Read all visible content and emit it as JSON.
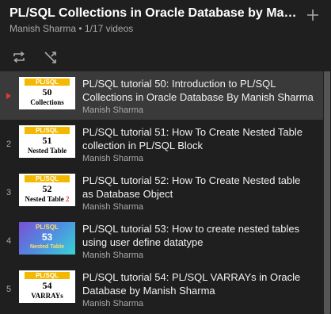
{
  "playlist": {
    "title": "PL/SQL Collections in Oracle Database by Manish Sharma",
    "meta": "Manish Sharma • 1/17 videos"
  },
  "icons": {
    "add": "plus-icon",
    "loop": "loop-icon",
    "shuffle": "shuffle-icon",
    "now_playing": "play-indicator-icon"
  },
  "colors": {
    "background": "#1f1f1f",
    "active_row": "#3a3a3a",
    "now_playing": "#e53935",
    "thumb_band": "#f5b800"
  },
  "videos": [
    {
      "index": "",
      "title": "PL/SQL tutorial 50: Introduction to PL/SQL Collections in Oracle Database By Manish Sharma",
      "channel": "Manish Sharma",
      "thumb": {
        "band": "PL/SQL",
        "number": "50",
        "subtitle": "Collections",
        "subtitle_accent": ""
      }
    },
    {
      "index": "2",
      "title": "PL/SQL tutorial 51: How To Create Nested Table collection in PL/SQL Block",
      "channel": "Manish Sharma",
      "thumb": {
        "band": "PL/SQL",
        "number": "51",
        "subtitle": "Nested Table",
        "subtitle_accent": ""
      }
    },
    {
      "index": "3",
      "title": "PL/SQL tutorial 52: How To Create Nested table as Database Object",
      "channel": "Manish Sharma",
      "thumb": {
        "band": "PL/SQL",
        "number": "52",
        "subtitle": "Nested Table",
        "subtitle_accent": "2"
      }
    },
    {
      "index": "4",
      "title": "PL/SQL tutorial 53: How to create nested tables using user define datatype",
      "channel": "Manish Sharma",
      "thumb": {
        "band": "PL/SQL",
        "number": "53",
        "subtitle": "Nested Table",
        "subtitle_accent": ""
      }
    },
    {
      "index": "5",
      "title": "PL/SQL tutorial 54: PL/SQL VARRAYs in Oracle Database by Manish Sharma",
      "channel": "Manish Sharma",
      "thumb": {
        "band": "PL/SQL",
        "number": "54",
        "subtitle": "VARRAYs",
        "subtitle_accent": ""
      }
    }
  ]
}
